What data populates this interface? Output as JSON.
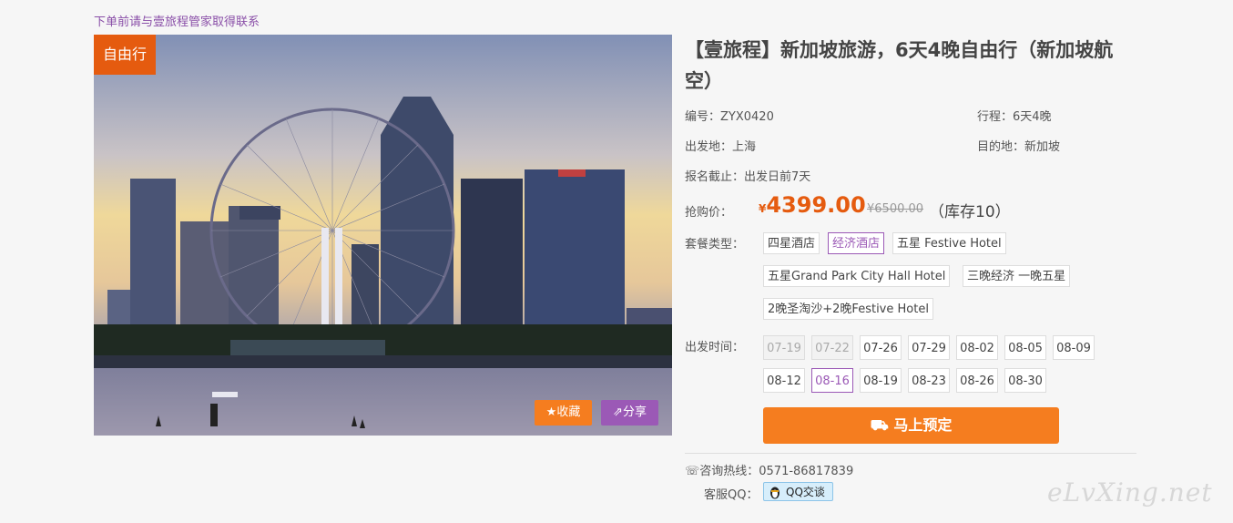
{
  "notice": "下单前请与壹旅程管家取得联系",
  "badge": "自由行",
  "actions": {
    "favorite": "收藏",
    "share": "分享"
  },
  "title": "【壹旅程】新加坡旅游，6天4晚自由行（新加坡航空）",
  "info": {
    "code": "编号：ZYX0420",
    "duration": "行程：6天4晚",
    "from": "出发地：上海",
    "to": "目的地：新加坡",
    "deadline": "报名截止：出发日前7天"
  },
  "price": {
    "label": "抢购价：",
    "currency": "¥",
    "value": "4399.00",
    "original": "¥6500.00",
    "stock": "（库存10）"
  },
  "packages": {
    "label": "套餐类型：",
    "items": [
      "四星酒店",
      "经济酒店",
      "五星 Festive Hotel",
      "五星Grand Park City Hall Hotel",
      "三晚经济 一晚五星",
      "2晚圣淘沙+2晚Festive Hotel"
    ],
    "selected": "经济酒店"
  },
  "dates": {
    "label": "出发时间：",
    "items": [
      "07-19",
      "07-22",
      "07-26",
      "07-29",
      "08-02",
      "08-05",
      "08-09",
      "08-12",
      "08-16",
      "08-19",
      "08-23",
      "08-26",
      "08-30"
    ],
    "disabled": [
      "07-19",
      "07-22"
    ],
    "selected": "08-16"
  },
  "book_label": "马上预定",
  "hotline": "咨询热线：0571-86817839",
  "qq": {
    "label": "客服QQ：",
    "button": "QQ交谈"
  },
  "watermark": "eLvXing.net",
  "colors": {
    "accent": "#f57d1f",
    "purple": "#9b59b6",
    "badge": "#e55b0f"
  }
}
